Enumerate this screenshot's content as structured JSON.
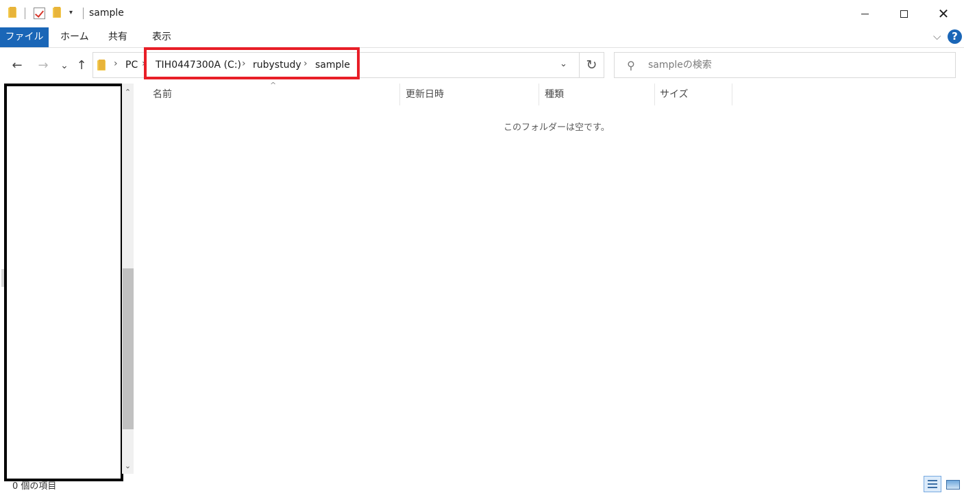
{
  "window": {
    "title": "sample",
    "quick_access_arrow": "▾",
    "minimize_label": "",
    "close_glyph": "✕"
  },
  "ribbon": {
    "tabs": [
      {
        "label": "ファイル"
      },
      {
        "label": "ホーム"
      },
      {
        "label": "共有"
      },
      {
        "label": "表示"
      }
    ],
    "expand_glyph": "⌵",
    "help_glyph": "?"
  },
  "nav": {
    "back_glyph": "←",
    "forward_glyph": "→",
    "recent_glyph": "⌄",
    "up_glyph": "↑",
    "breadcrumb": [
      "PC",
      "TIH0447300A (C:)",
      "rubystudy",
      "sample"
    ],
    "separator_glyph": "›",
    "address_dropdown_glyph": "⌄",
    "refresh_glyph": "↻",
    "search_icon_glyph": "⚲",
    "search_placeholder": "sampleの検索"
  },
  "columns": [
    "名前",
    "更新日時",
    "種類",
    "サイズ"
  ],
  "sort_glyph": "^",
  "empty_message": "このフォルダーは空です。",
  "scrollbar": {
    "up_glyph": "⌃",
    "down_glyph": "⌄"
  },
  "status": {
    "item_count": "0 個の項目"
  },
  "colors": {
    "accent": "#1a66b7",
    "highlight": "#e81e27"
  }
}
